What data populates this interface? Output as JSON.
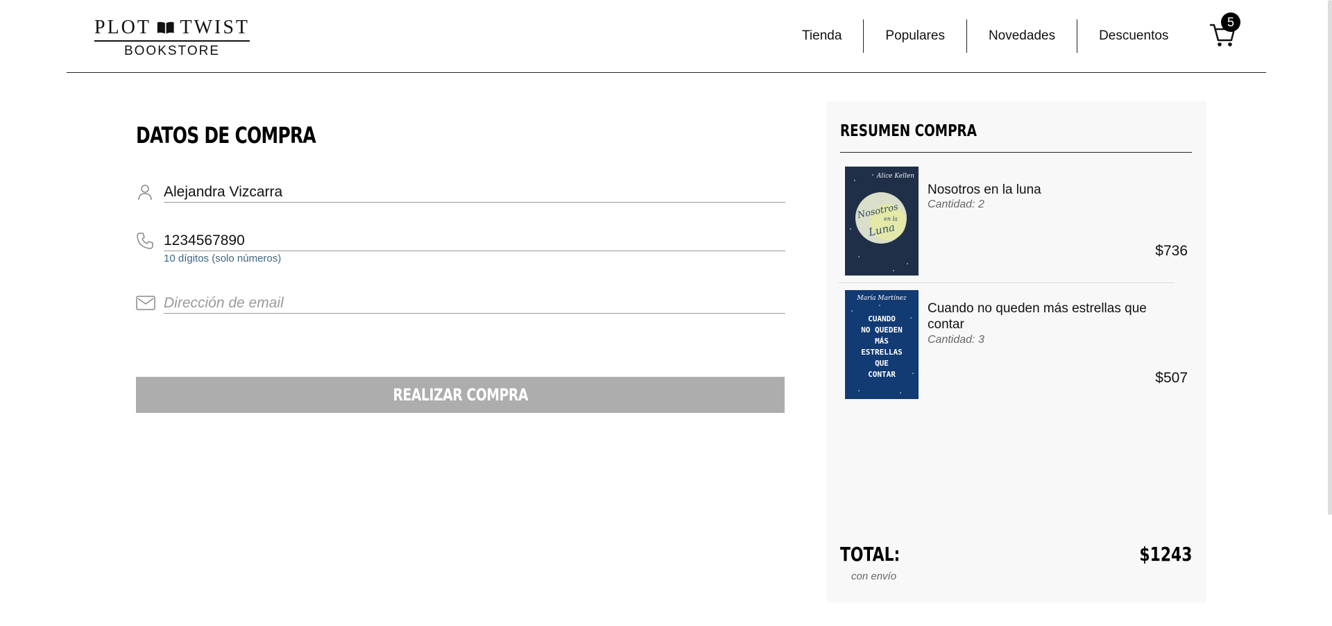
{
  "brand": {
    "name_top_left": "PLOT",
    "name_top_right": "TWIST",
    "name_bottom": "BOOKSTORE"
  },
  "nav": {
    "items": [
      "Tienda",
      "Populares",
      "Novedades",
      "Descuentos"
    ]
  },
  "cart": {
    "count": "5",
    "icon": "cart-icon"
  },
  "form": {
    "title": "DATOS DE COMPRA",
    "name": {
      "value": "Alejandra Vizcarra",
      "icon": "user-icon"
    },
    "phone": {
      "value": "1234567890",
      "hint": "10 dígitos (solo números)",
      "icon": "phone-icon"
    },
    "email": {
      "placeholder": "Dirección de email",
      "icon": "mail-icon"
    },
    "submit_label": "REALIZAR COMPRA"
  },
  "summary": {
    "title": "RESUMEN COMPRA",
    "items": [
      {
        "title": "Nosotros en la luna",
        "quantity": "Cantidad: 2",
        "price": "$736",
        "cover_author": "Alice Kellen",
        "cover_title": [
          "Nosotros",
          "en la",
          "Luna"
        ]
      },
      {
        "title": "Cuando no queden más estrellas que contar",
        "quantity": "Cantidad: 3",
        "price": "$507",
        "cover_author": "María Martínez",
        "cover_title": [
          "CUANDO",
          "NO QUEDEN",
          "MÁS",
          "ESTRELLAS",
          "QUE",
          "CONTAR"
        ]
      }
    ],
    "total_label": "TOTAL:",
    "total_value": "$1243",
    "total_note": "con envío"
  },
  "colors": {
    "button_disabled": "#adadad",
    "hint": "#3d6580",
    "panel": "#f8f8f8"
  }
}
